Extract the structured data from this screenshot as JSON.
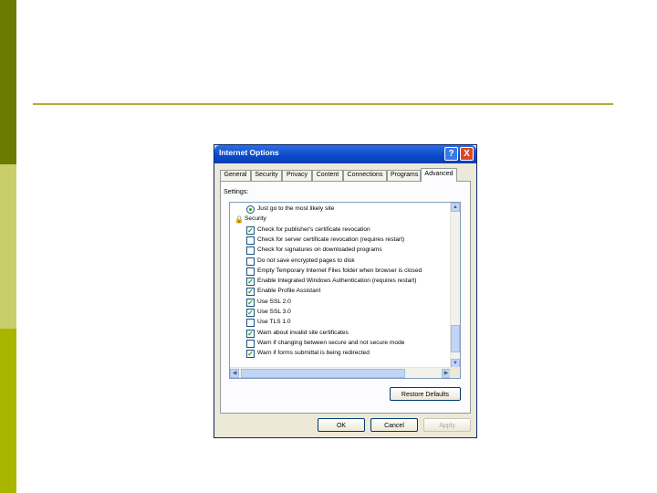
{
  "colors": {
    "side_top": "#6b7a00",
    "side_mid": "#c8cf6a",
    "side_bot": "#a9b600",
    "rule": "#b3ab2e",
    "titlebar": "#0a49c8",
    "check": "#21a121"
  },
  "dialog": {
    "title": "Internet Options",
    "help_label": "?",
    "close_label": "X",
    "tabs": [
      {
        "label": "General",
        "active": false
      },
      {
        "label": "Security",
        "active": false
      },
      {
        "label": "Privacy",
        "active": false
      },
      {
        "label": "Content",
        "active": false
      },
      {
        "label": "Connections",
        "active": false
      },
      {
        "label": "Programs",
        "active": false
      },
      {
        "label": "Advanced",
        "active": true
      }
    ],
    "settings_label": "Settings:",
    "items": [
      {
        "type": "radio",
        "label": "Just go to the most likely site",
        "checked": true
      },
      {
        "type": "group",
        "label": "Security",
        "icon": "lock-icon"
      },
      {
        "type": "checkbox",
        "label": "Check for publisher's certificate revocation",
        "checked": true
      },
      {
        "type": "checkbox",
        "label": "Check for server certificate revocation (requires restart)",
        "checked": false
      },
      {
        "type": "checkbox",
        "label": "Check for signatures on downloaded programs",
        "checked": false
      },
      {
        "type": "checkbox",
        "label": "Do not save encrypted pages to disk",
        "checked": false
      },
      {
        "type": "checkbox",
        "label": "Empty Temporary Internet Files folder when browser is closed",
        "checked": false
      },
      {
        "type": "checkbox",
        "label": "Enable Integrated Windows Authentication (requires restart)",
        "checked": true
      },
      {
        "type": "checkbox",
        "label": "Enable Profile Assistant",
        "checked": true
      },
      {
        "type": "checkbox",
        "label": "Use SSL 2.0",
        "checked": true
      },
      {
        "type": "checkbox",
        "label": "Use SSL 3.0",
        "checked": true
      },
      {
        "type": "checkbox",
        "label": "Use TLS 1.0",
        "checked": false
      },
      {
        "type": "checkbox",
        "label": "Warn about invalid site certificates",
        "checked": true
      },
      {
        "type": "checkbox",
        "label": "Warn if changing between secure and not secure mode",
        "checked": false
      },
      {
        "type": "checkbox",
        "label": "Warn if forms submittal is being redirected",
        "checked": true
      }
    ],
    "restore_defaults_label": "Restore Defaults",
    "ok_label": "OK",
    "cancel_label": "Cancel",
    "apply_label": "Apply",
    "apply_enabled": false
  }
}
